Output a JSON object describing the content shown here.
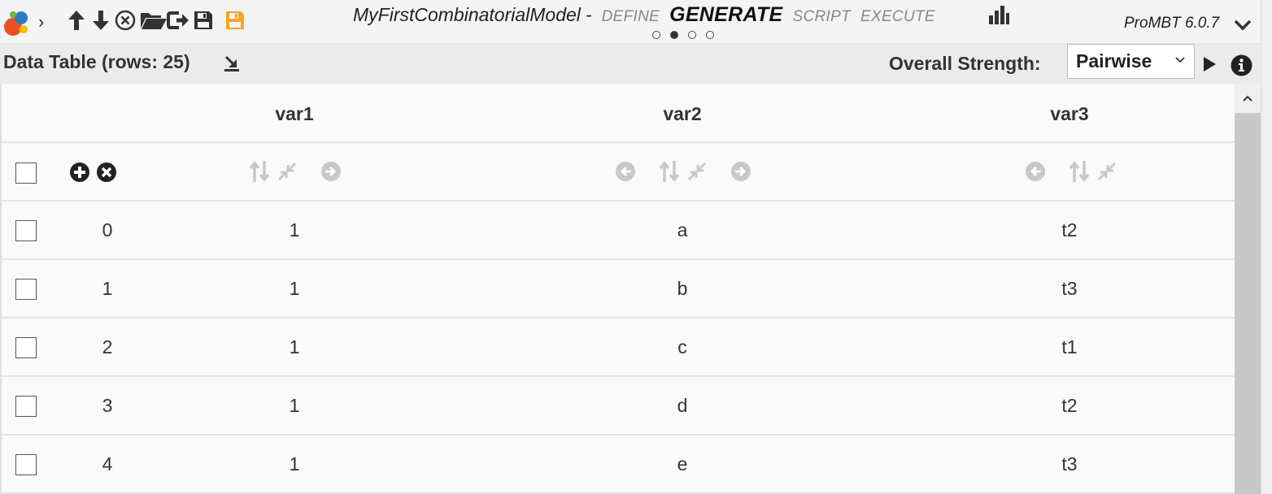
{
  "app": {
    "model_name": "MyFirstCombinatorialModel",
    "separator": "-",
    "modes": [
      "DEFINE",
      "GENERATE",
      "SCRIPT",
      "EXECUTE"
    ],
    "active_mode": "GENERATE",
    "version": "ProMBT 6.0.7",
    "page_indicator": {
      "total": 4,
      "current": 2
    }
  },
  "toolbar": {
    "icons": [
      "app-logo-icon",
      "chevron-right-icon",
      "arrow-up-icon",
      "arrow-down-icon",
      "close-circle-icon",
      "folder-open-icon",
      "export-arrow-icon",
      "save-icon",
      "save-orange-icon",
      "bar-chart-icon",
      "chevron-down-icon"
    ],
    "accent_orange": "#f5a623"
  },
  "data_table": {
    "title": "Data Table (rows: 25)",
    "strength_label": "Overall Strength:",
    "strength_value": "Pairwise",
    "columns": [
      "var1",
      "var2",
      "var3"
    ],
    "rows": [
      {
        "index": "0",
        "values": [
          "1",
          "a",
          "t2"
        ]
      },
      {
        "index": "1",
        "values": [
          "1",
          "b",
          "t3"
        ]
      },
      {
        "index": "2",
        "values": [
          "1",
          "c",
          "t1"
        ]
      },
      {
        "index": "3",
        "values": [
          "1",
          "d",
          "t2"
        ]
      },
      {
        "index": "4",
        "values": [
          "1",
          "e",
          "t3"
        ]
      }
    ]
  }
}
